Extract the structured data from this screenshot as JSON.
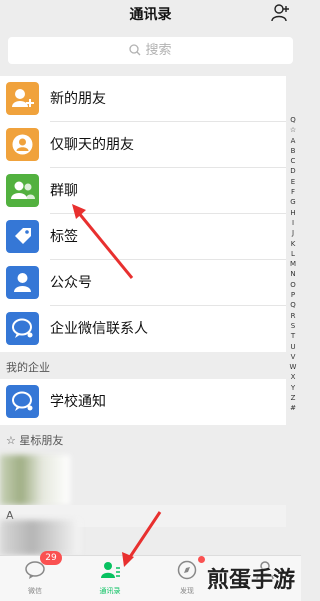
{
  "header": {
    "title": "通讯录"
  },
  "search": {
    "placeholder": "搜索"
  },
  "items": [
    {
      "label": "新的朋友",
      "color": "#f0a23c"
    },
    {
      "label": "仅聊天的朋友",
      "color": "#f0a23c"
    },
    {
      "label": "群聊",
      "color": "#52b13f"
    },
    {
      "label": "标签",
      "color": "#3577d6"
    },
    {
      "label": "公众号",
      "color": "#3577d6"
    },
    {
      "label": "企业微信联系人",
      "color": "#3577d6"
    }
  ],
  "sections": {
    "enterprise": "我的企业",
    "starred": "☆ 星标朋友",
    "a_group": "A"
  },
  "enterprise_items": [
    {
      "label": "学校通知",
      "color": "#3577d6"
    }
  ],
  "index_letters": [
    "Q",
    "☆",
    "A",
    "B",
    "C",
    "D",
    "E",
    "F",
    "G",
    "H",
    "I",
    "J",
    "K",
    "L",
    "M",
    "N",
    "O",
    "P",
    "Q",
    "R",
    "S",
    "T",
    "U",
    "V",
    "W",
    "X",
    "Y",
    "Z",
    "#"
  ],
  "tabs": [
    {
      "label": "微信",
      "active": false,
      "badge": "29"
    },
    {
      "label": "通讯录",
      "active": true
    },
    {
      "label": "发现",
      "active": false
    }
  ],
  "watermark": "煎蛋手游",
  "accent": "#07c160"
}
